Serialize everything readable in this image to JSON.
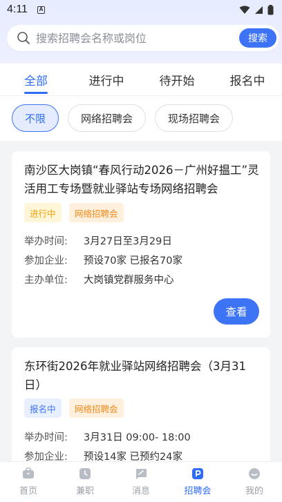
{
  "status": {
    "time": "4:11",
    "notif_letter": "A"
  },
  "search": {
    "placeholder": "搜索招聘会名称或岗位",
    "button_label": "搜索"
  },
  "tabs": [
    {
      "label": "全部",
      "active": true
    },
    {
      "label": "进行中",
      "active": false
    },
    {
      "label": "待开始",
      "active": false
    },
    {
      "label": "报名中",
      "active": false
    }
  ],
  "filters": [
    {
      "label": "不限",
      "active": true
    },
    {
      "label": "网络招聘会",
      "active": false
    },
    {
      "label": "现场招聘会",
      "active": false
    }
  ],
  "labels": {
    "time": "举办时间:",
    "companies": "参加企业:",
    "organizer": "主办单位:"
  },
  "cards": [
    {
      "title": "南沙区大岗镇“春风行动2026－广州好揾工”灵活用工专场暨就业驿站专场网络招聘会",
      "status_tag": "进行中",
      "type_tag": "网络招聘会",
      "time": "3月27日至3月29日",
      "companies": "预设70家 已报名70家",
      "organizer": "大岗镇党群服务中心",
      "button_label": "查看"
    },
    {
      "title": "东环街2026年就业驿站网络招聘会（3月31日）",
      "status_tag": "报名中",
      "type_tag": "网络招聘会",
      "time": "3月31日 09:00- 18:00",
      "companies": "预设14家 已预约24家"
    }
  ],
  "bottom_nav": [
    {
      "label": "首页",
      "icon": "briefcase-icon",
      "active": false
    },
    {
      "label": "兼职",
      "icon": "clock-icon",
      "active": false
    },
    {
      "label": "消息",
      "icon": "message-icon",
      "active": false
    },
    {
      "label": "招聘会",
      "icon": "job-fair-icon",
      "active": true
    },
    {
      "label": "我的",
      "icon": "profile-icon",
      "active": false
    }
  ],
  "colors": {
    "accent": "#3d73f5",
    "running": "#f2a100",
    "type": "#f08a1a"
  }
}
